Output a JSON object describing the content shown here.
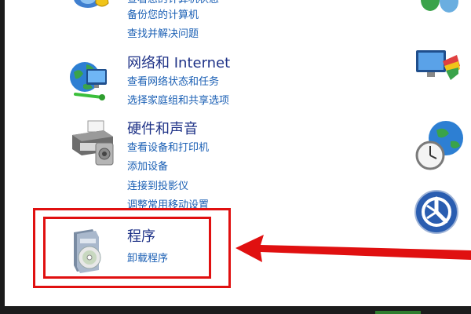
{
  "categories": [
    {
      "title": "",
      "links": [
        "查看您的计算机状态",
        "备份您的计算机",
        "查找并解决问题"
      ],
      "icon": "system-security-icon"
    },
    {
      "title": "网络和 Internet",
      "links": [
        "查看网络状态和任务",
        "选择家庭组和共享选项"
      ],
      "icon": "network-globe-icon"
    },
    {
      "title": "硬件和声音",
      "links": [
        "查看设备和打印机",
        "添加设备",
        "连接到投影仪",
        "调整常用移动设置"
      ],
      "icon": "printer-icon"
    },
    {
      "title": "程序",
      "links": [
        "卸载程序"
      ],
      "icon": "programs-cd-icon"
    }
  ],
  "right_icons": [
    "user-accounts-icon",
    "appearance-monitor-icon",
    "clock-globe-icon",
    "ease-of-access-icon"
  ],
  "annotation": {
    "color": "#e01010"
  }
}
